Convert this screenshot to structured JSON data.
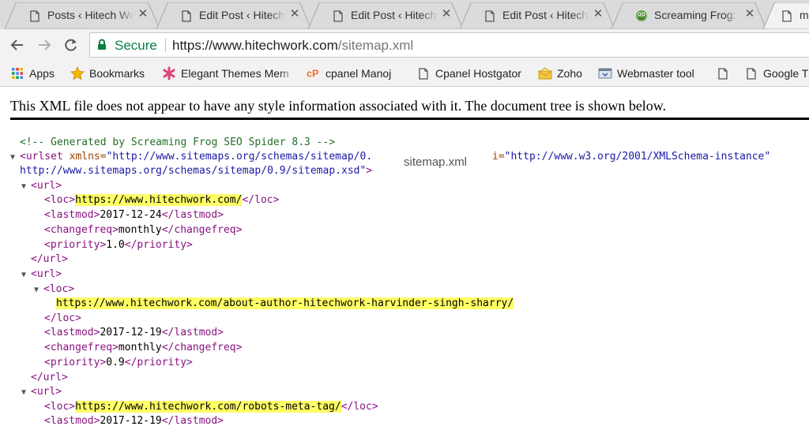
{
  "tabs": [
    {
      "title": "Posts ‹ Hitech Wor",
      "icon": "page-icon"
    },
    {
      "title": "Edit Post ‹ Hitech W",
      "icon": "page-icon"
    },
    {
      "title": "Edit Post ‹ Hitech W",
      "icon": "page-icon"
    },
    {
      "title": "Edit Post ‹ Hitech W",
      "icon": "page-icon"
    },
    {
      "title": "Screaming Frog: S",
      "icon": "frog-icon"
    },
    {
      "title": "m",
      "icon": "page-icon"
    }
  ],
  "omnibox": {
    "secure_label": "Secure",
    "url_origin": "https://www.hitechwork.com",
    "url_path": "/sitemap.xml"
  },
  "bookmarks": [
    {
      "label": "Apps",
      "icon": "apps-grid-icon"
    },
    {
      "label": "Bookmarks",
      "icon": "star-icon"
    },
    {
      "label": "Elegant Themes Mem",
      "icon": "elegant-themes-icon"
    },
    {
      "label": "cpanel Manoj",
      "icon": "cpanel-icon"
    },
    {
      "label": "Cpanel Hostgator",
      "icon": "page-icon"
    },
    {
      "label": "Zoho",
      "icon": "zoho-icon"
    },
    {
      "label": "Webmaster tool",
      "icon": "webmaster-icon"
    },
    {
      "label": "",
      "icon": "page-icon"
    },
    {
      "label": "Google T",
      "icon": "page-icon"
    }
  ],
  "notice": "This XML file does not appear to have any style information associated with it. The document tree is shown below.",
  "tooltip": "sitemap.xml",
  "xml": {
    "comment": "<!-- Generated by Screaming Frog SEO Spider 8.3 -->",
    "urlset_open_a": "<urlset",
    "urlset_attr1_name": " xmlns=",
    "urlset_attr1_value": "\"http://www.sitemaps.org/schemas/sitemap/0.",
    "urlset_attr2_tail": "i=",
    "urlset_attr2_value": "\"http://www.w3.org/2001/XMLSchema-instance\"",
    "urlset_line2": "http://www.sitemaps.org/schemas/sitemap/0.9/sitemap.xsd\"",
    "urlset_line2_close": ">",
    "entries": [
      {
        "loc": "https://www.hitechwork.com/",
        "lastmod": "2017-12-24",
        "changefreq": "monthly",
        "priority": "1.0"
      },
      {
        "loc": "https://www.hitechwork.com/about-author-hitechwork-harvinder-singh-sharry/",
        "lastmod": "2017-12-19",
        "changefreq": "monthly",
        "priority": "0.9"
      },
      {
        "loc": "https://www.hitechwork.com/robots-meta-tag/",
        "lastmod": "2017-12-19"
      }
    ],
    "tags": {
      "url_open": "<url>",
      "url_close": "</url>",
      "loc_open": "<loc>",
      "loc_close": "</loc>",
      "lastmod_open": "<lastmod>",
      "lastmod_close": "</lastmod>",
      "changefreq_open": "<changefreq>",
      "changefreq_close": "</changefreq>",
      "priority_open": "<priority>",
      "priority_close": "</priority>"
    }
  },
  "colors": {
    "tag": "#881280",
    "attr": "#994500",
    "value": "#1a1aa6",
    "comment": "#236e25",
    "highlight": "#ffff66",
    "secure": "#0b8043"
  }
}
